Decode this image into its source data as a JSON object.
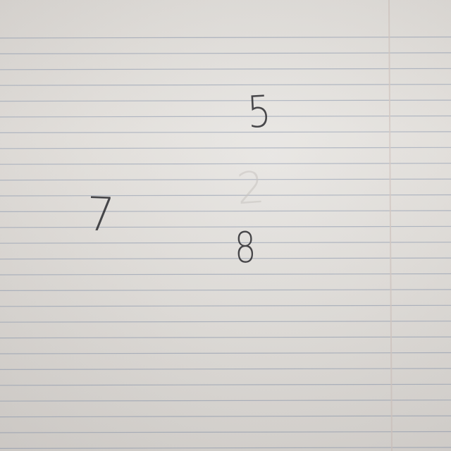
{
  "paper": {
    "color": "#e4e1dd",
    "rule_color": "#9fa8b8",
    "margin_line_color": "#d4c9c4",
    "ruled_line_count": 27
  },
  "digits": {
    "five": "5",
    "seven": "7",
    "eight": "8",
    "faint_erased": "2"
  },
  "ink_color": "#2f2f33"
}
